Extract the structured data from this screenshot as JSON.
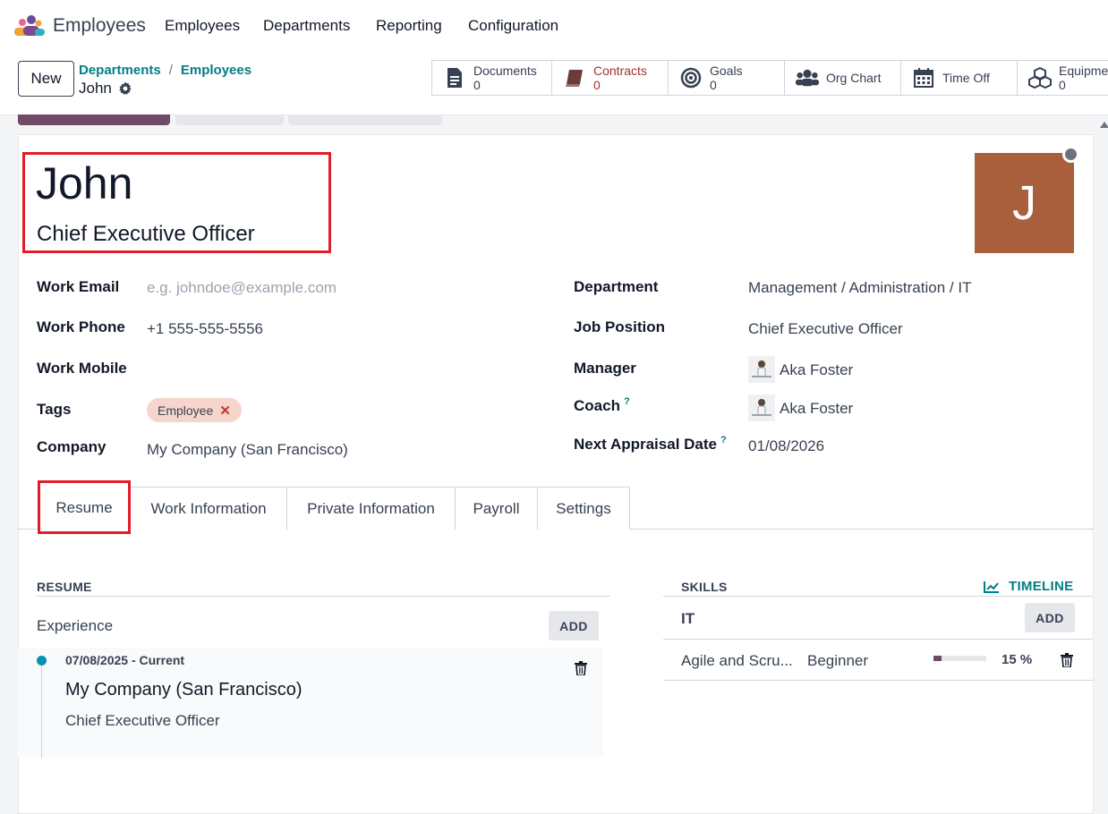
{
  "navbar": {
    "app_name": "Employees",
    "menu": [
      "Employees",
      "Departments",
      "Reporting",
      "Configuration"
    ]
  },
  "control": {
    "new_label": "New",
    "breadcrumb": [
      "Departments",
      "Employees"
    ],
    "current": "John",
    "smart_buttons": [
      {
        "label": "Documents",
        "count": "0",
        "icon": "document-icon"
      },
      {
        "label": "Contracts",
        "count": "0",
        "icon": "book-icon"
      },
      {
        "label": "Goals",
        "count": "0",
        "icon": "target-icon"
      },
      {
        "label": "Org Chart",
        "count": "",
        "icon": "users-icon"
      },
      {
        "label": "Time Off",
        "count": "",
        "icon": "calendar-icon"
      },
      {
        "label": "Equipme",
        "count": "0",
        "icon": "boxes-icon"
      }
    ]
  },
  "employee": {
    "name": "John",
    "job_title": "Chief Executive Officer",
    "avatar_letter": "J",
    "avatar_color": "#a95f3c"
  },
  "fields": {
    "work_email_label": "Work Email",
    "work_email_placeholder": "e.g. johndoe@example.com",
    "work_phone_label": "Work Phone",
    "work_phone": "+1 555-555-5556",
    "work_mobile_label": "Work Mobile",
    "tags_label": "Tags",
    "tag": "Employee",
    "company_label": "Company",
    "company": "My Company (San Francisco)",
    "department_label": "Department",
    "department": "Management / Administration / IT",
    "job_position_label": "Job Position",
    "job_position": "Chief Executive Officer",
    "manager_label": "Manager",
    "manager": "Aka Foster",
    "coach_label": "Coach",
    "coach": "Aka Foster",
    "appraisal_label": "Next Appraisal Date",
    "appraisal": "01/08/2026",
    "help_mark": "?"
  },
  "tabs": [
    "Resume",
    "Work Information",
    "Private Information",
    "Payroll",
    "Settings"
  ],
  "resume": {
    "title": "RESUME",
    "experience_label": "Experience",
    "add_label": "ADD",
    "entry": {
      "dates": "07/08/2025 - Current",
      "company": "My Company (San Francisco)",
      "position": "Chief Executive Officer"
    }
  },
  "skills": {
    "title": "SKILLS",
    "timeline_label": "TIMELINE",
    "group": "IT",
    "add_label": "ADD",
    "skill": {
      "name": "Agile and Scru...",
      "level": "Beginner",
      "progress": "15 %",
      "progress_value": 15
    }
  },
  "colors": {
    "accent": "#017e84",
    "brand": "#714b67",
    "highlight": "#e11d2a"
  }
}
